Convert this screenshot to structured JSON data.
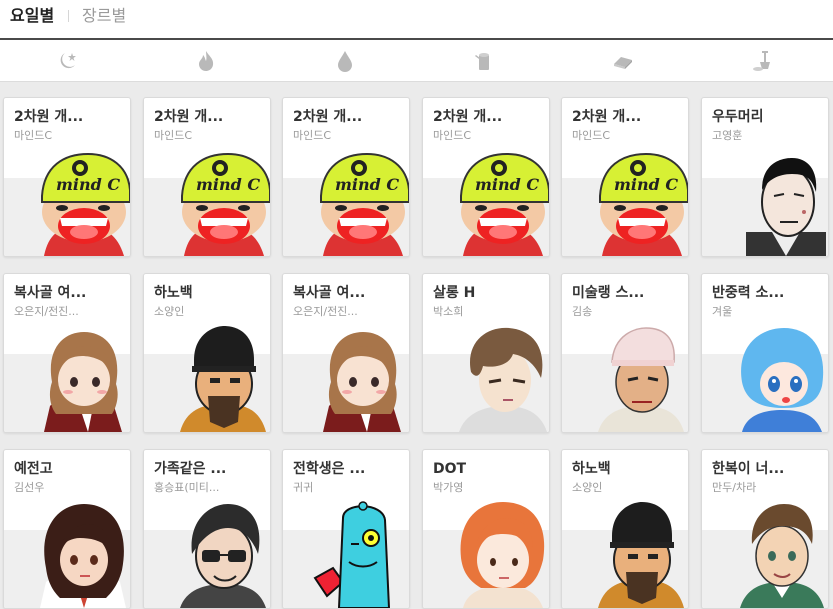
{
  "tabs": {
    "active": "요일별",
    "inactive": "장르별"
  },
  "day_icons": [
    "moon-icon",
    "fire-icon",
    "water-drop-icon",
    "tree-stump-icon",
    "gold-bar-icon",
    "shovel-icon"
  ],
  "colors": {
    "icon": "#b9b9b9",
    "band": "#efefef",
    "title": "#333333",
    "author": "#9a9a9a"
  },
  "cards": [
    {
      "title": "2차원 개...",
      "author": "마인드C",
      "thumb": "mindc"
    },
    {
      "title": "2차원 개...",
      "author": "마인드C",
      "thumb": "mindc"
    },
    {
      "title": "2차원 개...",
      "author": "마인드C",
      "thumb": "mindc"
    },
    {
      "title": "2차원 개...",
      "author": "마인드C",
      "thumb": "mindc"
    },
    {
      "title": "2차원 개...",
      "author": "마인드C",
      "thumb": "mindc"
    },
    {
      "title": "우두머리",
      "author": "고영훈",
      "thumb": "oldman"
    },
    {
      "title": "복사골 여...",
      "author": "오은지/전진...",
      "thumb": "girl-brown"
    },
    {
      "title": "하노백",
      "author": "소양인",
      "thumb": "scholar"
    },
    {
      "title": "복사골 여...",
      "author": "오은지/전진...",
      "thumb": "girl-brown"
    },
    {
      "title": "살롱 H",
      "author": "박소희",
      "thumb": "bishonen"
    },
    {
      "title": "미술랭 스...",
      "author": "김송",
      "thumb": "cap-guy"
    },
    {
      "title": "반중력 소...",
      "author": "겨울",
      "thumb": "blue-girl"
    },
    {
      "title": "예전고",
      "author": "김선우",
      "thumb": "dark-girl"
    },
    {
      "title": "가족같은 ...",
      "author": "홍승표(미티...",
      "thumb": "glasses"
    },
    {
      "title": "전학생은 ...",
      "author": "귀귀",
      "thumb": "alien"
    },
    {
      "title": "DOT",
      "author": "박가영",
      "thumb": "orange-hair"
    },
    {
      "title": "하노백",
      "author": "소양인",
      "thumb": "scholar"
    },
    {
      "title": "한복이 너...",
      "author": "만두/차라",
      "thumb": "boy"
    }
  ]
}
